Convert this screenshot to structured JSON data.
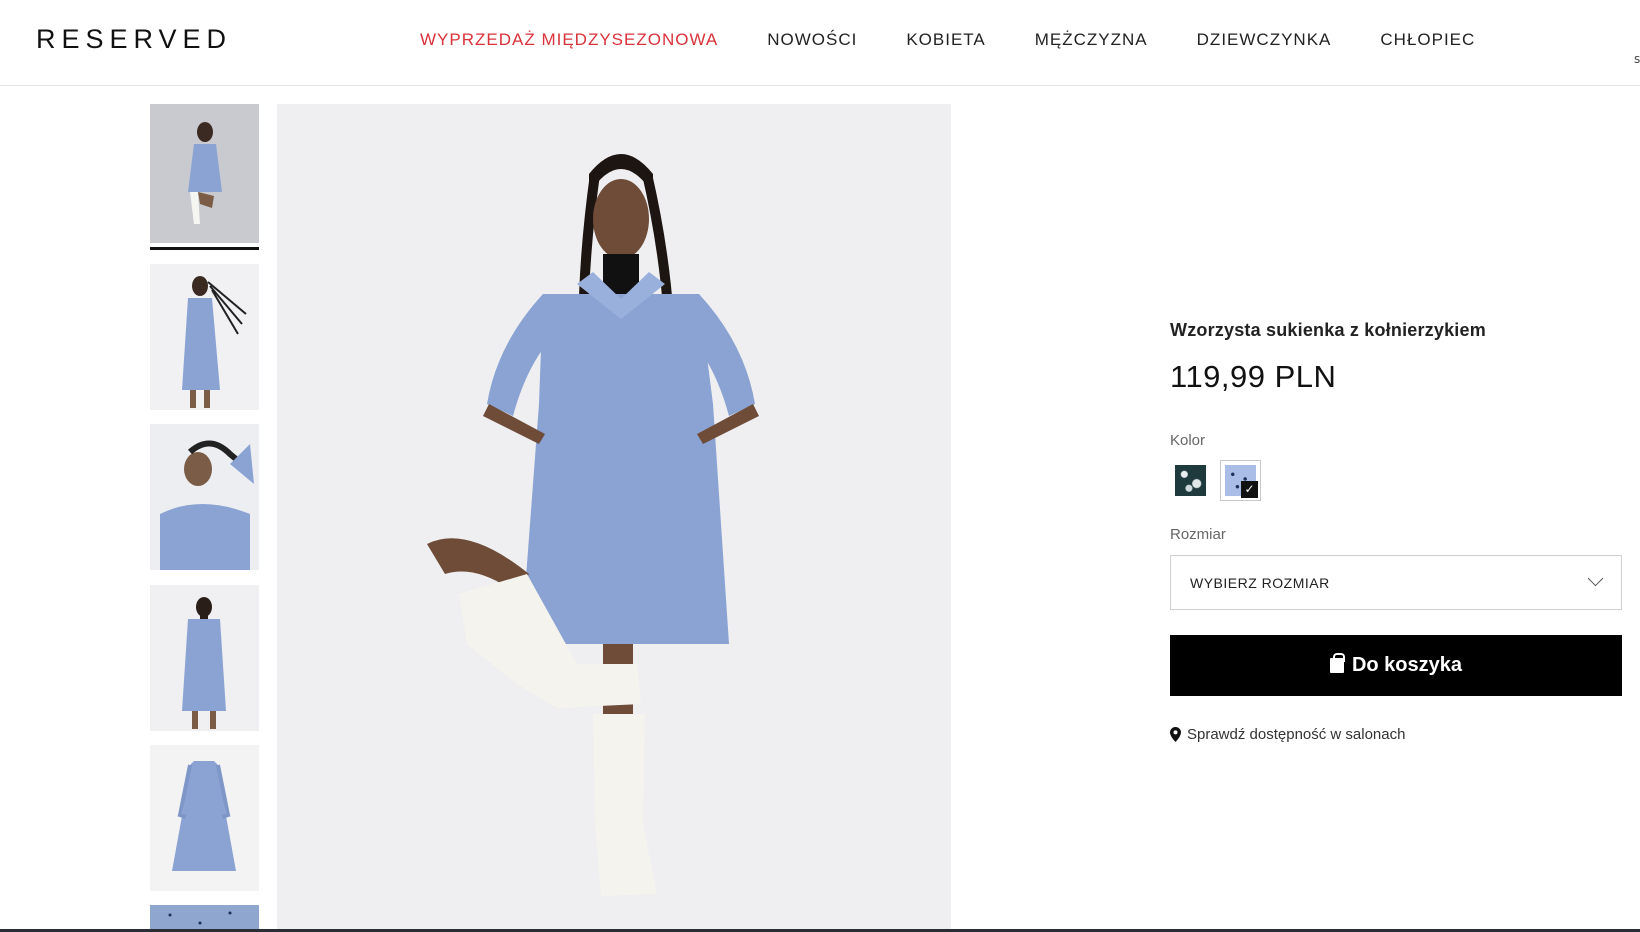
{
  "header": {
    "logo": "RESERVED",
    "nav": [
      {
        "label": "WYPRZEDAŻ MIĘDZYSEZONOWA",
        "highlight": true
      },
      {
        "label": "NOWOŚCI"
      },
      {
        "label": "KOBIETA"
      },
      {
        "label": "MĘŻCZYZNA"
      },
      {
        "label": "DZIEWCZYNKA"
      },
      {
        "label": "CHŁOPIEC"
      }
    ],
    "edge_text": "s"
  },
  "gallery": {
    "thumbnail_count_visible": 6,
    "active_index": 0
  },
  "product": {
    "title": "Wzorzysta sukienka z kołnierzykiem",
    "price": "119,99 PLN",
    "color_label": "Kolor",
    "colors": [
      {
        "name": "dark-green-floral",
        "hex": "#1f3a3d",
        "selected": false
      },
      {
        "name": "blue-dotted",
        "hex": "#a9bde6",
        "selected": true
      }
    ],
    "size_label": "Rozmiar",
    "size_placeholder": "WYBIERZ ROZMIAR",
    "add_to_cart": "Do koszyka",
    "store_availability": "Sprawdź dostępność w salonach"
  },
  "colors": {
    "sale_red": "#d9323a",
    "button_black": "#000000",
    "dress_blue": "#8aa3d3"
  }
}
